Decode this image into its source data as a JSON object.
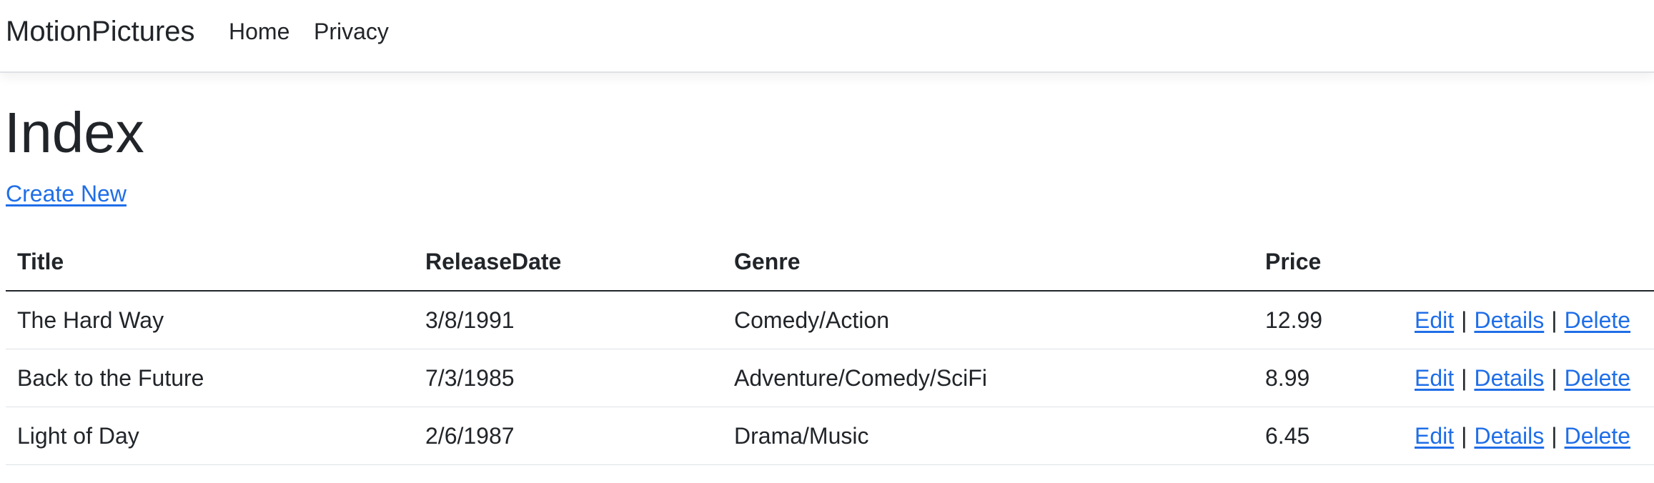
{
  "navbar": {
    "brand": "MotionPictures",
    "links": [
      "Home",
      "Privacy"
    ]
  },
  "page": {
    "title": "Index",
    "create_new": "Create New"
  },
  "table": {
    "headers": [
      "Title",
      "ReleaseDate",
      "Genre",
      "Price",
      ""
    ],
    "rows": [
      {
        "title": "The Hard Way",
        "release_date": "3/8/1991",
        "genre": "Comedy/Action",
        "price": "12.99"
      },
      {
        "title": "Back to the Future",
        "release_date": "7/3/1985",
        "genre": "Adventure/Comedy/SciFi",
        "price": "8.99"
      },
      {
        "title": "Light of Day",
        "release_date": "2/6/1987",
        "genre": "Drama/Music",
        "price": "6.45"
      }
    ],
    "actions": {
      "edit": "Edit",
      "details": "Details",
      "delete": "Delete",
      "separator": "|"
    }
  },
  "colors": {
    "link": "#1f6ee8",
    "text": "#212529",
    "border": "#dee2e6"
  }
}
